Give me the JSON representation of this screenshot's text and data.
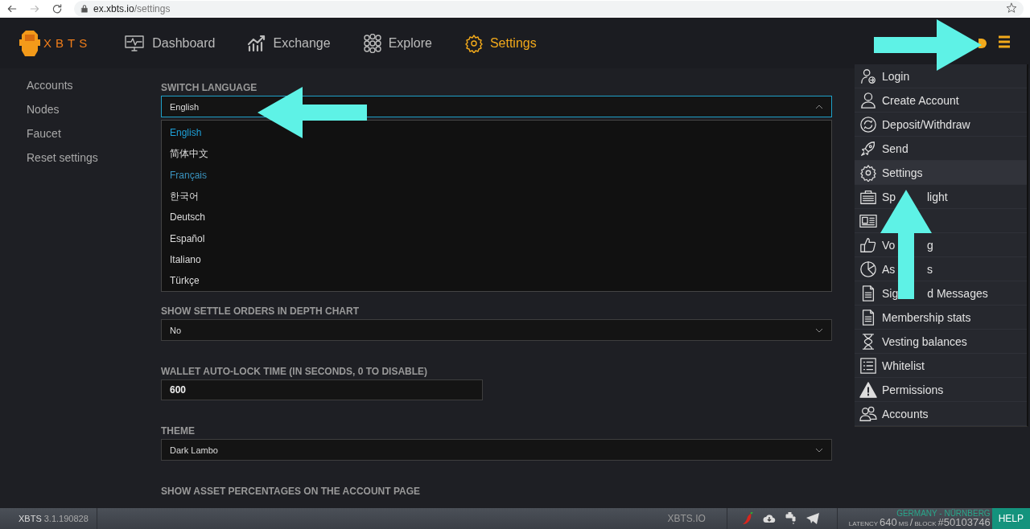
{
  "browser": {
    "host": "ex.xbts.io",
    "path": "/settings",
    "forward_disabled": true
  },
  "nav": {
    "logo": "XBTS",
    "items": [
      {
        "label": "Dashboard",
        "selected": false
      },
      {
        "label": "Exchange",
        "selected": false
      },
      {
        "label": "Explore",
        "selected": false
      },
      {
        "label": "Settings",
        "selected": true
      }
    ]
  },
  "sidebar": {
    "items": [
      {
        "label": "Accounts"
      },
      {
        "label": "Nodes"
      },
      {
        "label": "Faucet"
      },
      {
        "label": "Reset settings"
      }
    ]
  },
  "settings": [
    {
      "kind": "select",
      "label": "SWITCH LANGUAGE",
      "value": "English",
      "expanded": true,
      "options": [
        {
          "label": "English",
          "selected": true,
          "hovered": false
        },
        {
          "label": "简体中文",
          "selected": false,
          "hovered": false
        },
        {
          "label": "Français",
          "selected": false,
          "hovered": true
        },
        {
          "label": "한국어",
          "selected": false,
          "hovered": false
        },
        {
          "label": "Deutsch",
          "selected": false,
          "hovered": false
        },
        {
          "label": "Español",
          "selected": false,
          "hovered": false
        },
        {
          "label": "Italiano",
          "selected": false,
          "hovered": false
        },
        {
          "label": "Türkçe",
          "selected": false,
          "hovered": false
        }
      ]
    },
    {
      "kind": "select",
      "label": "SHOW SETTLE ORDERS IN DEPTH CHART",
      "value": "No",
      "expanded": false
    },
    {
      "kind": "input",
      "label": "WALLET AUTO-LOCK TIME (IN SECONDS, 0 TO DISABLE)",
      "value": "600"
    },
    {
      "kind": "select",
      "label": "THEME",
      "value": "Dark Lambo",
      "expanded": false
    },
    {
      "kind": "heading",
      "label": "SHOW ASSET PERCENTAGES ON THE ACCOUNT PAGE"
    }
  ],
  "menu": {
    "items": [
      {
        "label": "Login",
        "selected": false
      },
      {
        "label": "Create Account",
        "selected": false
      },
      {
        "label": "Deposit/Withdraw",
        "selected": false
      },
      {
        "label": "Send",
        "selected": false
      },
      {
        "label": "Settings",
        "selected": true
      },
      {
        "label_parts": [
          "Sp",
          "light"
        ],
        "selected": false
      },
      {
        "selected": false
      },
      {
        "label_parts": [
          "Vo",
          "g"
        ],
        "selected": false
      },
      {
        "label_parts": [
          "As",
          "s"
        ],
        "selected": false
      },
      {
        "label_parts": [
          "Sig",
          "d Messages"
        ],
        "selected": false
      },
      {
        "label": "Membership stats",
        "selected": false
      },
      {
        "label": "Vesting balances",
        "selected": false
      },
      {
        "label": "Whitelist",
        "selected": false
      },
      {
        "label": "Permissions",
        "selected": false
      },
      {
        "label": "Accounts",
        "selected": false
      }
    ]
  },
  "footer": {
    "brand": "XBTS",
    "version": "3.1.190828",
    "site": "XBTS.IO",
    "location": "GERMANY - NÜRNBERG",
    "latency_label": "LATENCY",
    "latency_value": "640",
    "latency_unit": "MS",
    "slash": "/",
    "block_label": "BLOCK",
    "block_value": "#50103746",
    "help": "HELP"
  }
}
